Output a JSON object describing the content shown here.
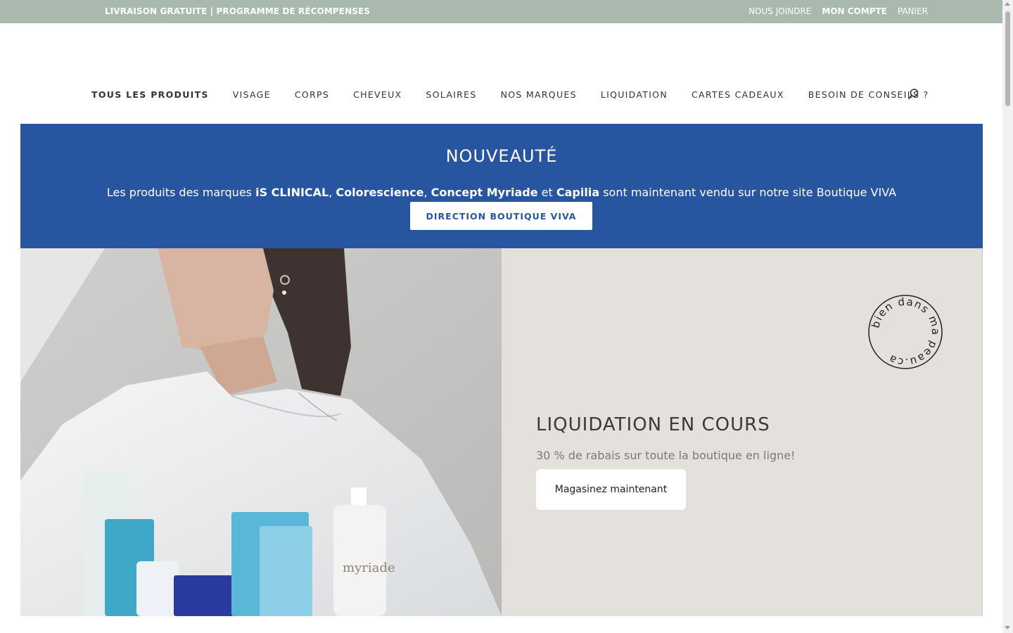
{
  "topbar": {
    "promo": "LIVRAISON GRATUITE | PROGRAMME DE RÉCOMPENSES",
    "links": {
      "contact": "NOUS JOINDRE",
      "account": "MON COMPTE",
      "cart": "PANIER"
    }
  },
  "nav": {
    "items": [
      "TOUS LES PRODUITS",
      "VISAGE",
      "CORPS",
      "CHEVEUX",
      "SOLAIRES",
      "NOS MARQUES",
      "LIQUIDATION",
      "CARTES CADEAUX",
      "BESOIN DE CONSEILS ?"
    ],
    "search_icon": "search-icon"
  },
  "banner": {
    "title": "NOUVEAUTÉ",
    "text": {
      "t1": "Les produits des marques ",
      "b1": "iS CLINICAL",
      "t2": ", ",
      "b2": "Colorescience",
      "t3": ", ",
      "b3": "Concept Myriade",
      "t4": " et ",
      "b4": "Capilia",
      "t5": " sont maintenant vendu sur notre site Boutique VIVA"
    },
    "cta": "DIRECTION BOUTIQUE VIVA",
    "background": "#2755a0"
  },
  "hero": {
    "heading": "LIQUIDATION EN COURS",
    "subtext": "30 % de rabais sur toute la boutique en ligne!",
    "button": "Magasinez maintenant",
    "seal_text": "bien dans ma peau.ca",
    "photo_product_text": "myriade"
  },
  "colors": {
    "topbar": "#a9b9ae",
    "banner": "#2755a0",
    "panel": "#e4e0dc"
  }
}
